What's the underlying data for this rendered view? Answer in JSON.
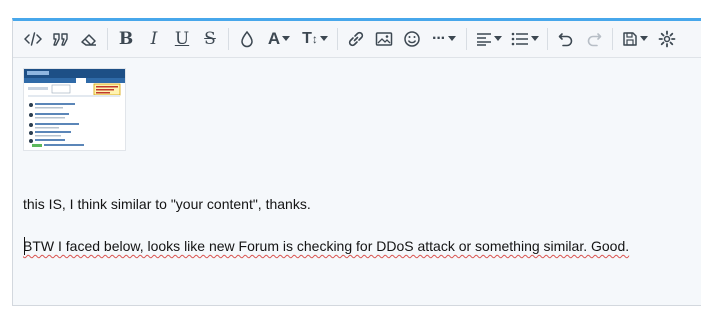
{
  "toolbar": {
    "buttons": [
      {
        "name": "source-code-icon",
        "label": "</>"
      },
      {
        "name": "quote-icon",
        "label": "99"
      },
      {
        "name": "eraser-icon",
        "label": ""
      },
      {
        "name": "bold-icon",
        "label": "B"
      },
      {
        "name": "italic-icon",
        "label": "I"
      },
      {
        "name": "underline-icon",
        "label": "U"
      },
      {
        "name": "strikethrough-icon",
        "label": "S"
      },
      {
        "name": "color-drop-icon",
        "label": ""
      },
      {
        "name": "font-family-icon",
        "label": "A"
      },
      {
        "name": "font-size-icon",
        "label": "TI"
      },
      {
        "name": "link-icon",
        "label": ""
      },
      {
        "name": "image-icon",
        "label": ""
      },
      {
        "name": "emoji-icon",
        "label": ""
      },
      {
        "name": "more-icon",
        "label": "…"
      },
      {
        "name": "align-icon",
        "label": ""
      },
      {
        "name": "list-icon",
        "label": ""
      },
      {
        "name": "undo-icon",
        "label": ""
      },
      {
        "name": "redo-icon",
        "label": ""
      },
      {
        "name": "save-draft-icon",
        "label": ""
      },
      {
        "name": "settings-gear-icon",
        "label": ""
      }
    ]
  },
  "content": {
    "line1": "this IS, I think similar to \"your content\", thanks.",
    "line2": "BTW I faced below, looks like new Forum is checking for DDoS attack or something similar. Good."
  },
  "colors": {
    "accent": "#47a7eb",
    "toolbar_bg": "#f5f7fa",
    "content_bg": "#f5f8fb",
    "spellcheck": "#d9534f"
  }
}
